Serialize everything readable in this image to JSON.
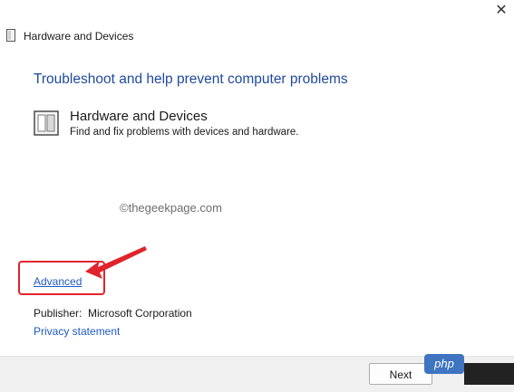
{
  "window": {
    "title": "Hardware and Devices",
    "close_glyph": "✕",
    "icon": "hardware-device-icon"
  },
  "main": {
    "heading": "Troubleshoot and help prevent computer problems",
    "item": {
      "title": "Hardware and Devices",
      "description": "Find and fix problems with devices and hardware.",
      "icon": "hardware-device-icon"
    },
    "watermark": "©thegeekpage.com",
    "advanced_label": "Advanced",
    "publisher_label": "Publisher:",
    "publisher_value": "Microsoft Corporation",
    "privacy_label": "Privacy statement"
  },
  "footer": {
    "next_label": "Next",
    "badge_text": "php"
  },
  "colors": {
    "heading": "#1f4a9c",
    "link": "#1f5ac4",
    "annotation": "#e0242b",
    "badge": "#3f74c1"
  }
}
